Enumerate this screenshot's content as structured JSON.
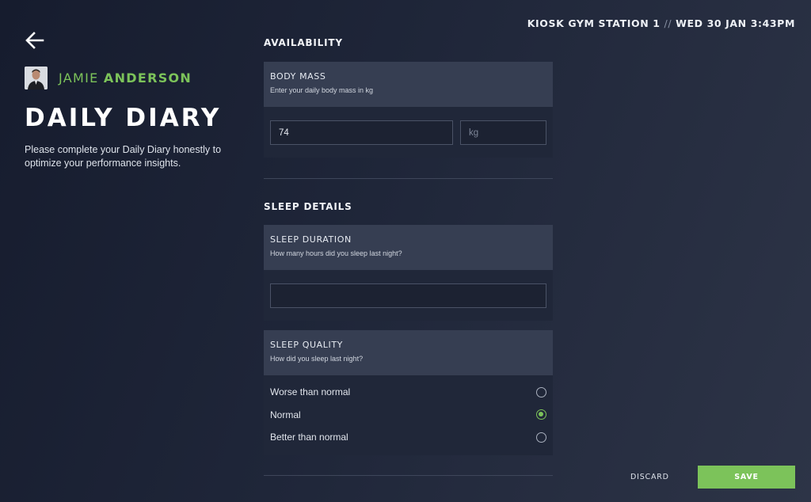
{
  "header": {
    "station": "KIOSK GYM STATION 1",
    "separator": "//",
    "datetime": "WED 30 JAN 3:43PM"
  },
  "user": {
    "first_name": "JAMIE",
    "last_name": "ANDERSON"
  },
  "page": {
    "title": "DAILY DIARY",
    "description": "Please complete your Daily Diary honestly to optimize your performance insights."
  },
  "availability": {
    "section_title": "AVAILABILITY",
    "body_mass": {
      "title": "BODY MASS",
      "subtitle": "Enter your daily body mass in kg",
      "value": "74",
      "unit_placeholder": "kg"
    }
  },
  "sleep": {
    "section_title": "SLEEP DETAILS",
    "duration": {
      "title": "SLEEP DURATION",
      "subtitle": "How many hours did you sleep last night?",
      "value": ""
    },
    "quality": {
      "title": "SLEEP QUALITY",
      "subtitle": "How did you sleep last night?",
      "options": [
        {
          "label": "Worse than normal",
          "selected": false
        },
        {
          "label": "Normal",
          "selected": true
        },
        {
          "label": "Better than normal",
          "selected": false
        }
      ]
    }
  },
  "actions": {
    "discard_label": "DISCARD",
    "save_label": "SAVE"
  },
  "colors": {
    "accent": "#7cc35a",
    "card_header": "#363e52",
    "card_body": "#202739"
  }
}
